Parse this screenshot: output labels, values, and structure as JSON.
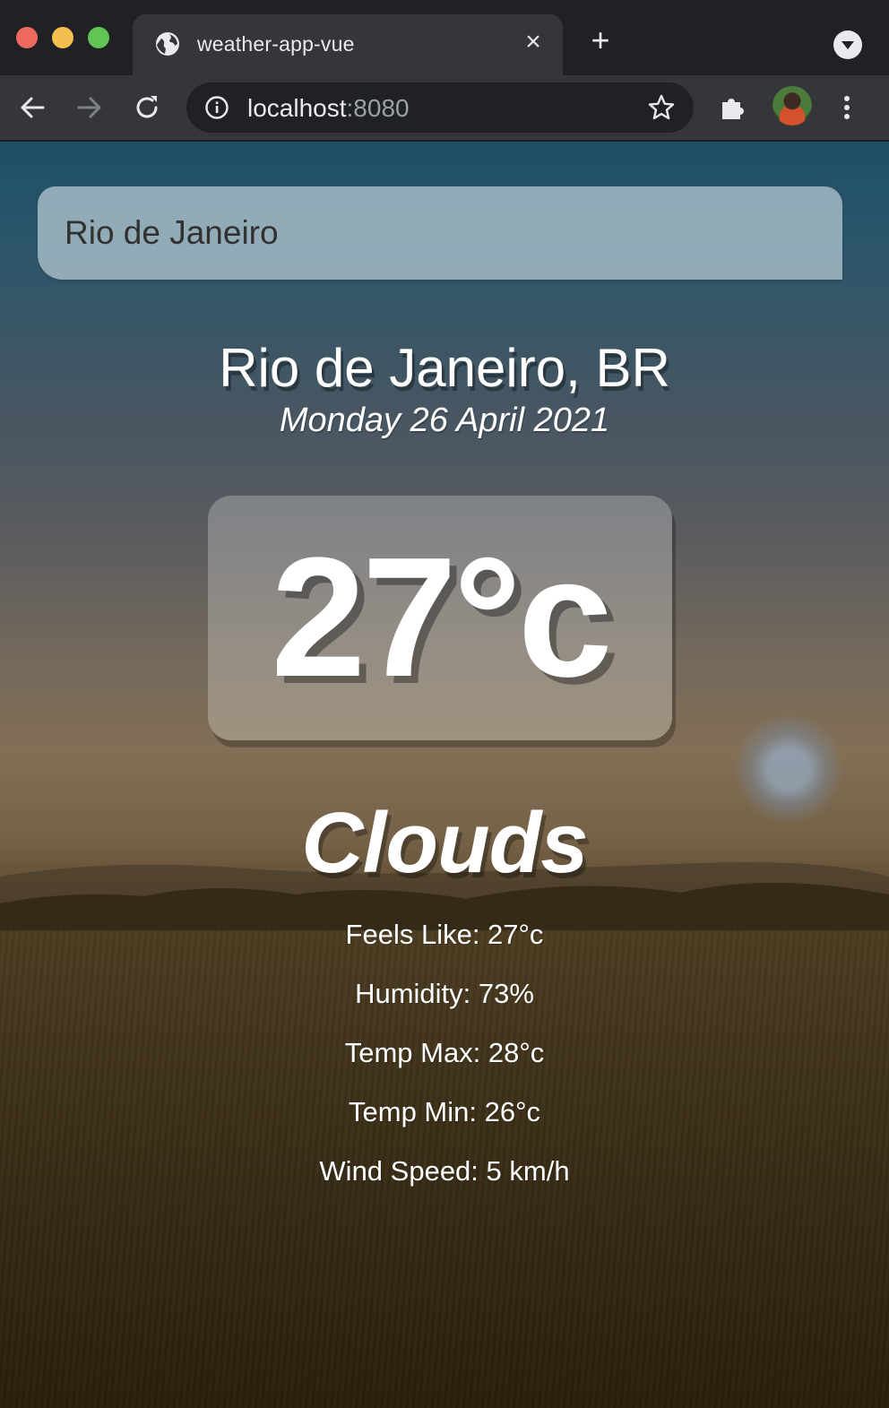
{
  "browser": {
    "tab_title": "weather-app-vue",
    "url_host": "localhost",
    "url_port": ":8080"
  },
  "search": {
    "value": "Rio de Janeiro"
  },
  "weather": {
    "location": "Rio de Janeiro, BR",
    "date": "Monday 26 April 2021",
    "temperature": "27°c",
    "condition": "Clouds",
    "details": [
      "Feels Like: 27°c",
      "Humidity: 73%",
      "Temp Max: 28°c",
      "Temp Min: 26°c",
      "Wind Speed: 5 km/h"
    ]
  },
  "colors": {
    "tab_bar": "#202124",
    "toolbar": "#35363a",
    "search_box": "#b4c8d2",
    "text": "#ffffff"
  },
  "icons": {
    "tab": "globe-icon",
    "close": "close-icon",
    "new_tab": "plus-icon",
    "back": "back-arrow-icon",
    "forward": "forward-arrow-icon",
    "reload": "reload-icon",
    "site_info": "info-icon",
    "bookmark": "star-icon",
    "extensions": "puzzle-icon",
    "menu": "kebab-menu-icon"
  }
}
